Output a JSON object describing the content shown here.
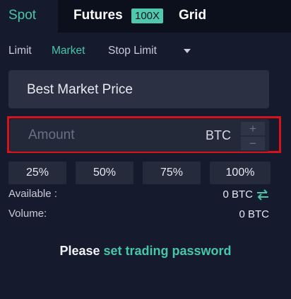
{
  "tabs": {
    "spot": "Spot",
    "futures": "Futures",
    "futures_badge": "100X",
    "grid": "Grid"
  },
  "order_types": {
    "limit": "Limit",
    "market": "Market",
    "stop_limit": "Stop Limit"
  },
  "price_field": {
    "value": "Best Market Price"
  },
  "amount_field": {
    "placeholder": "Amount",
    "unit": "BTC",
    "plus": "+",
    "minus": "−"
  },
  "percent_buttons": [
    "25%",
    "50%",
    "75%",
    "100%"
  ],
  "info": {
    "available_label": "Available :",
    "available_value": "0 BTC",
    "volume_label": "Volume:",
    "volume_value": "0 BTC"
  },
  "footer": {
    "prefix": "Please",
    "link": "set trading password"
  },
  "colors": {
    "background": "#161a2d",
    "accent": "#48c7a8",
    "highlight_outline": "#d4131b"
  }
}
